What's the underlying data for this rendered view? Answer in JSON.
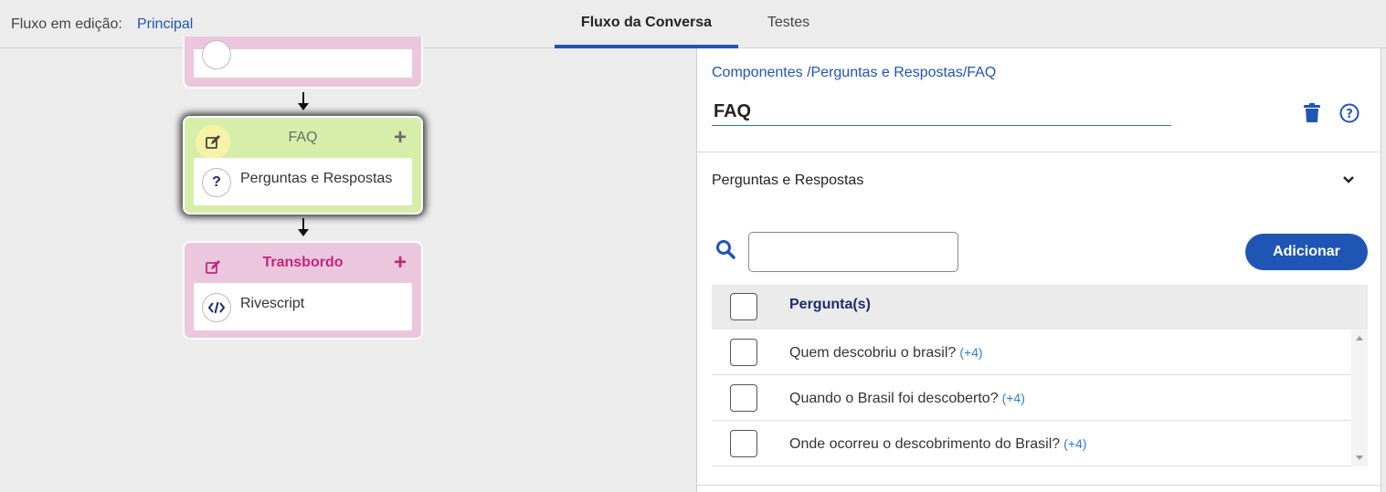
{
  "header": {
    "flow_label": "Fluxo em edição:",
    "flow_name": "Principal",
    "tabs": [
      {
        "label": "Fluxo da Conversa",
        "active": true
      },
      {
        "label": "Testes",
        "active": false
      }
    ]
  },
  "canvas": {
    "cards": [
      {
        "title": "FAQ",
        "component_label": "Perguntas e Respostas",
        "color": "#d6eeaa",
        "selected": true,
        "icon": "question-icon"
      },
      {
        "title": "Transbordo",
        "component_label": "Rivescript",
        "color": "#ecc6dd",
        "selected": false,
        "icon": "code-icon"
      }
    ],
    "accent_pink": "#c0287f"
  },
  "panel": {
    "breadcrumb": "Componentes /Perguntas e Respostas/FAQ",
    "name_value": "FAQ",
    "section_title": "Perguntas e Respostas",
    "search_placeholder": "",
    "add_button": "Adicionar",
    "table": {
      "header": "Pergunta(s)",
      "rows": [
        {
          "text": "Quem descobriu o brasil?",
          "count": "(+4)"
        },
        {
          "text": "Quando o Brasil foi descoberto?",
          "count": "(+4)"
        },
        {
          "text": "Onde ocorreu o descobrimento do Brasil?",
          "count": "(+4)"
        }
      ]
    }
  },
  "colors": {
    "primary": "#1f55b5",
    "link": "#2d7dd2"
  }
}
